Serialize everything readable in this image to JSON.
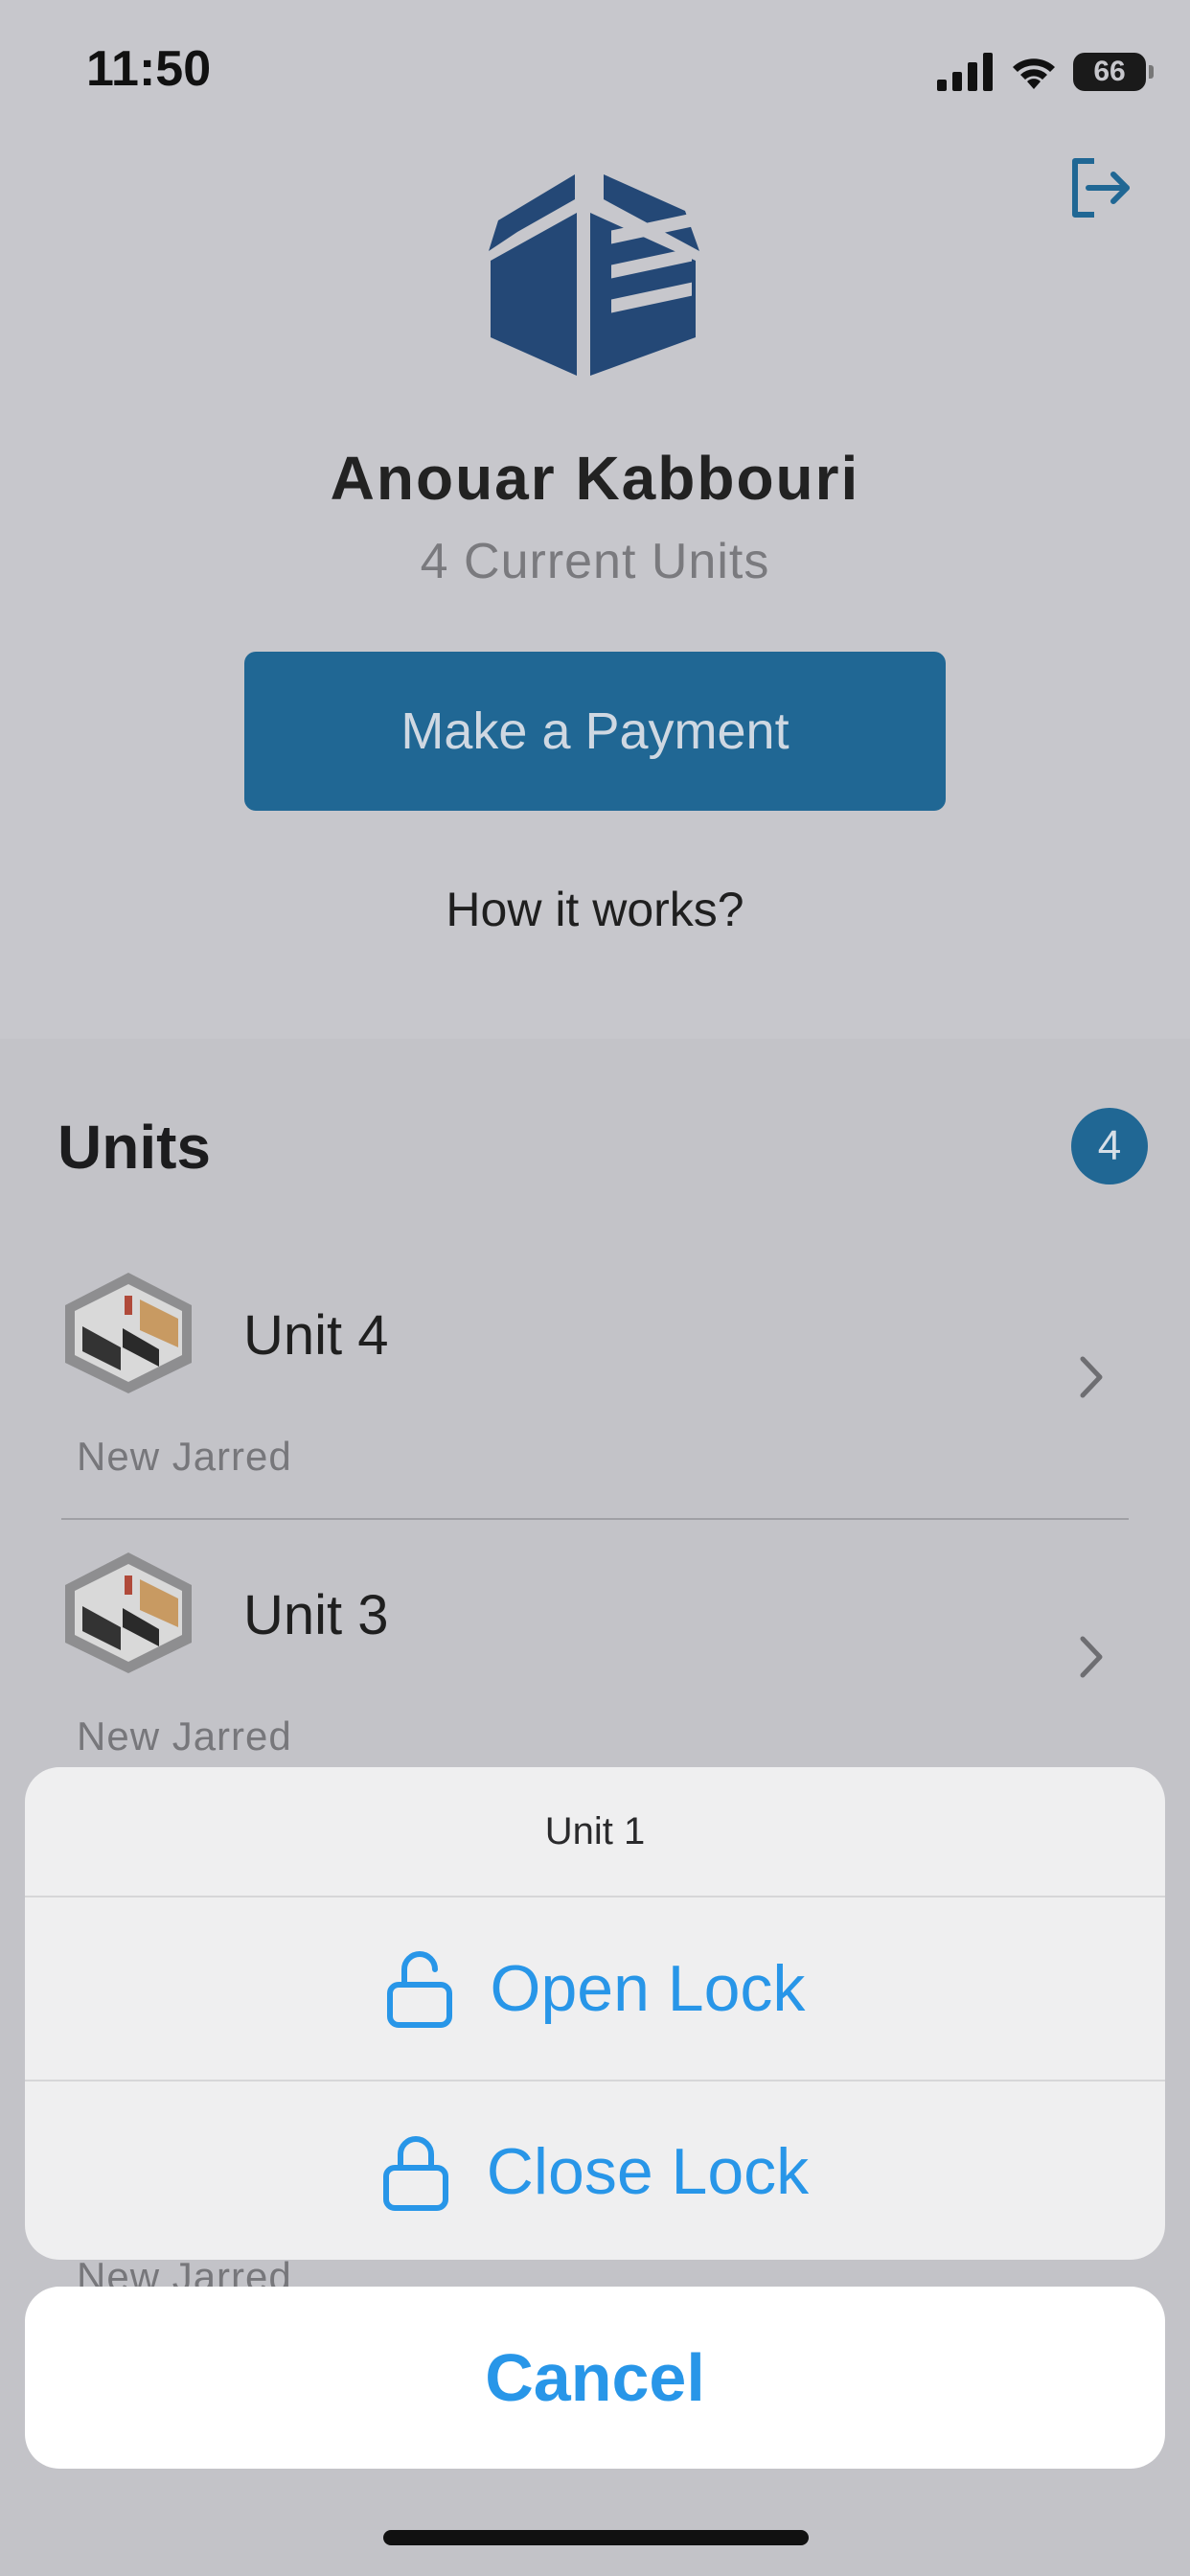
{
  "status_bar": {
    "time": "11:50",
    "battery": "66"
  },
  "header": {
    "user_name": "Anouar Kabbouri",
    "units_count": "4 Current Units",
    "pay_button": "Make a Payment",
    "how_link": "How it works?"
  },
  "units": {
    "title": "Units",
    "badge": "4",
    "items": [
      {
        "name": "Unit 4",
        "location": "New Jarred"
      },
      {
        "name": "Unit 3",
        "location": "New Jarred"
      }
    ],
    "peek_location": "New Jarred"
  },
  "action_sheet": {
    "title": "Unit 1",
    "open_label": "Open Lock",
    "close_label": "Close Lock",
    "cancel_label": "Cancel"
  },
  "colors": {
    "brand": "#206794",
    "action": "#2896e8"
  }
}
